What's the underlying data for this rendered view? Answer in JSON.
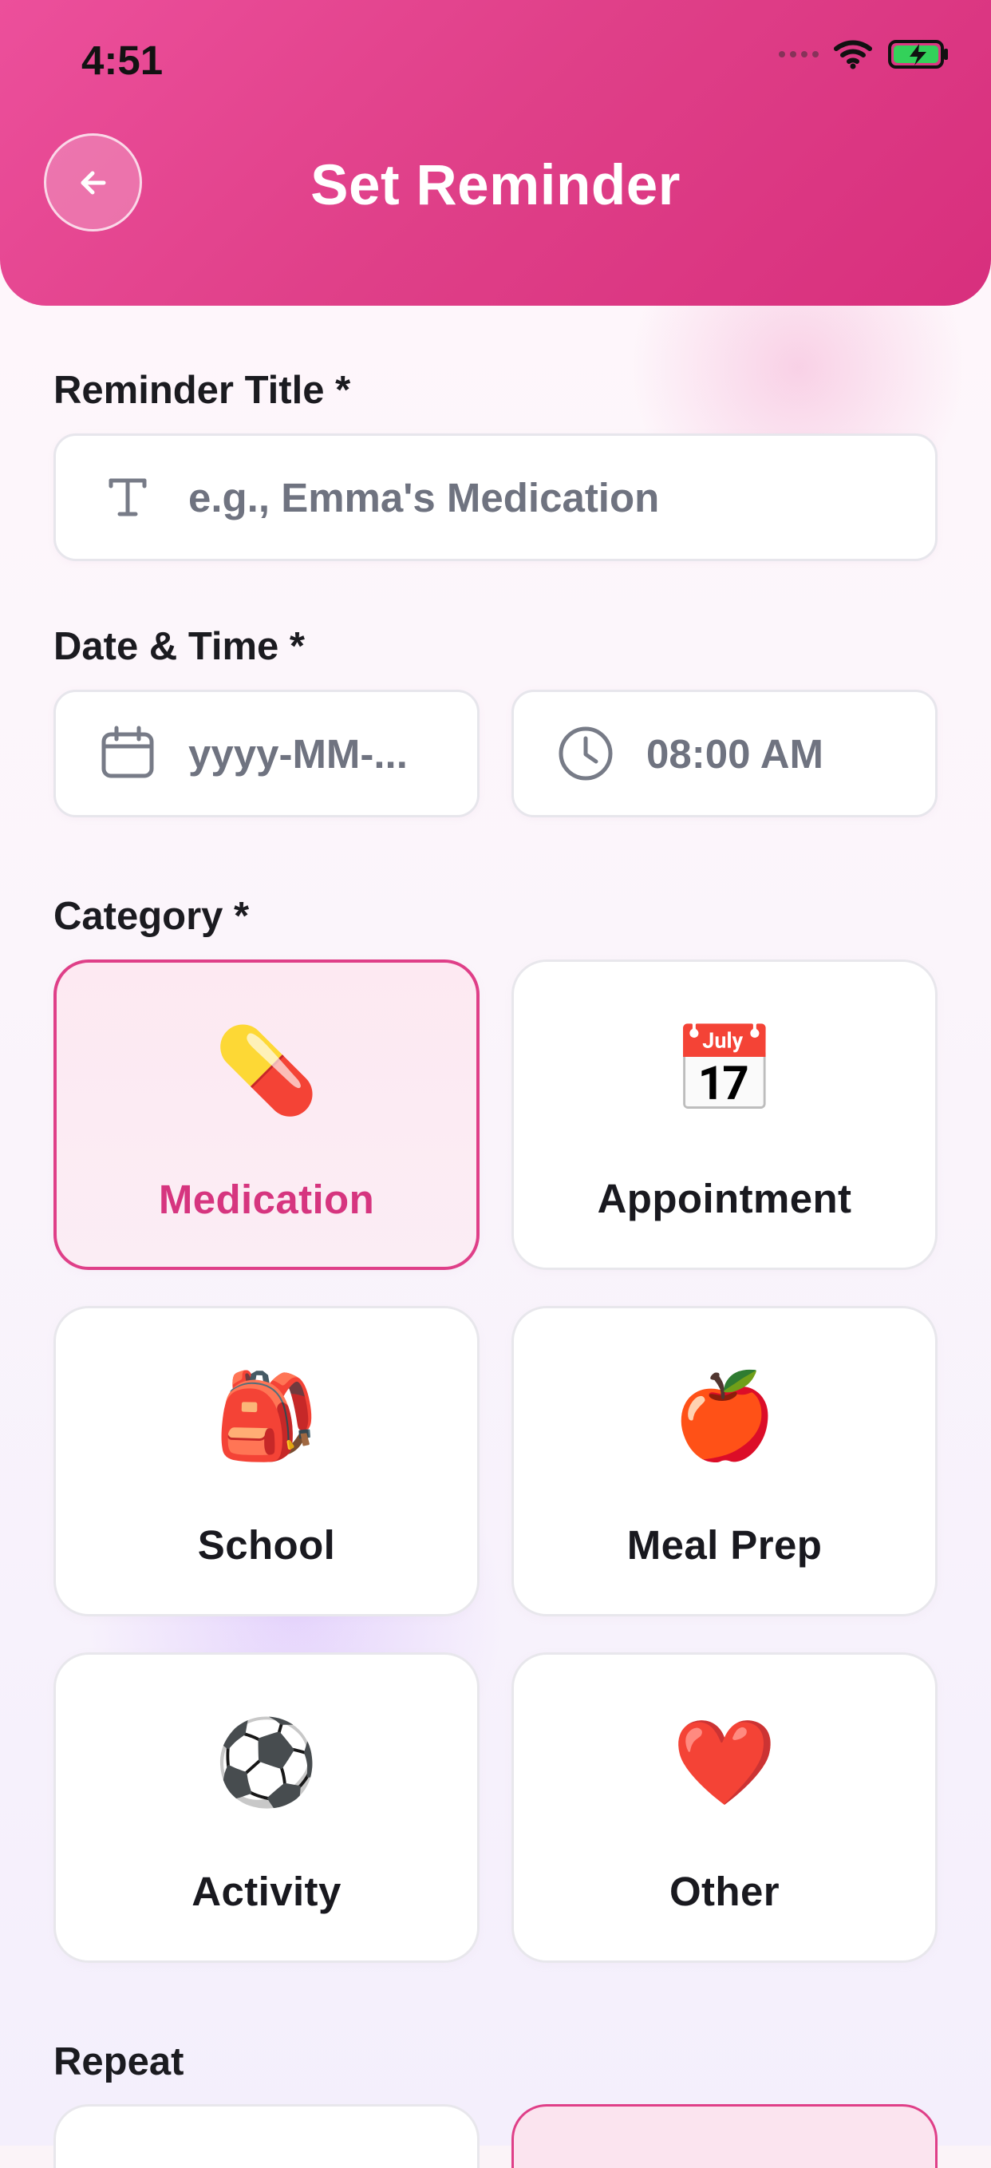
{
  "status_bar": {
    "time": "4:51",
    "icons": [
      "cellular-signal-icon",
      "wifi-icon",
      "battery-charging-icon"
    ]
  },
  "header": {
    "title": "Set Reminder",
    "back_icon": "arrow-left-icon",
    "background_gradient": [
      "#ec4f9b",
      "#d82f7d"
    ]
  },
  "form": {
    "reminder_title": {
      "label": "Reminder Title *",
      "placeholder": "e.g., Emma's Medication",
      "icon": "text-icon"
    },
    "date_time": {
      "label": "Date & Time *",
      "date_placeholder": "yyyy-MM-...",
      "date_icon": "calendar-icon",
      "time_value": "08:00 AM",
      "time_icon": "clock-icon"
    },
    "category": {
      "label": "Category *",
      "selected": "Medication",
      "items": [
        {
          "label": "Medication",
          "emoji": "💊",
          "icon": "pill-icon"
        },
        {
          "label": "Appointment",
          "emoji": "📅",
          "icon": "calendar-emoji-icon"
        },
        {
          "label": "School",
          "emoji": "🎒",
          "icon": "backpack-icon"
        },
        {
          "label": "Meal Prep",
          "emoji": "🍎",
          "icon": "apple-icon"
        },
        {
          "label": "Activity",
          "emoji": "⚽",
          "icon": "soccer-ball-icon"
        },
        {
          "label": "Other",
          "emoji": "❤️",
          "icon": "heart-icon"
        }
      ]
    },
    "repeat": {
      "label": "Repeat"
    }
  },
  "colors": {
    "accent": "#df3f88",
    "field_text": "#6f7380",
    "card_border": "#e8e7ec",
    "selected_card_background": "#fde9f2"
  }
}
